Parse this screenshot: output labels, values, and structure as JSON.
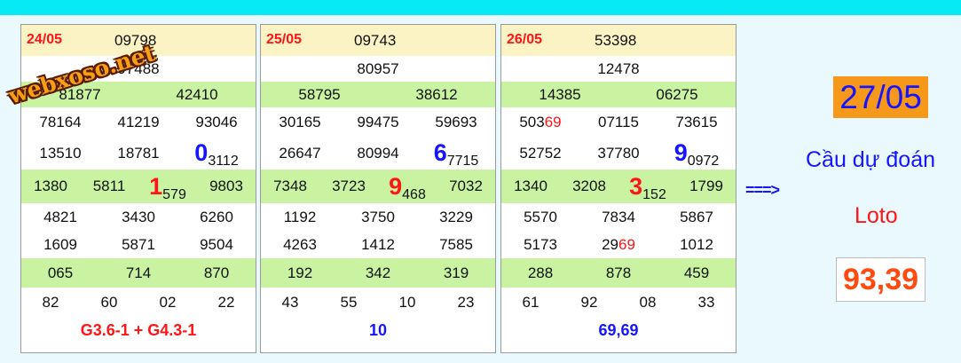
{
  "panels": [
    {
      "date": "24/05",
      "special": "09798",
      "r1": [
        "97488"
      ],
      "r2": [
        "81877",
        "42410"
      ],
      "r3": [
        "78164",
        "41219",
        "93046"
      ],
      "r4": [
        "13510",
        "18781"
      ],
      "r4_big_digit": "0",
      "r4_big_rest": "3112",
      "r5a": [
        "1380",
        "5811"
      ],
      "r5_big_digit": "1",
      "r5_big_rest": "579",
      "r5b": [
        "9803"
      ],
      "r6": [
        "4821",
        "3430",
        "6260"
      ],
      "r7": [
        "1609",
        "5871",
        "9504"
      ],
      "r8": [
        "065",
        "714",
        "870"
      ],
      "r9": [
        "82",
        "60",
        "02",
        "22"
      ],
      "footer": "G3.6-1 + G4.3-1"
    },
    {
      "date": "25/05",
      "special": "09743",
      "r1": [
        "80957"
      ],
      "r2": [
        "58795",
        "38612"
      ],
      "r3": [
        "30165",
        "99475",
        "59693"
      ],
      "r4": [
        "26647",
        "80994"
      ],
      "r4_big_digit": "6",
      "r4_big_rest": "7715",
      "r5a": [
        "7348",
        "3723"
      ],
      "r5_big_digit": "9",
      "r5_big_rest": "468",
      "r5b": [
        "7032"
      ],
      "r6": [
        "1192",
        "3750",
        "3229"
      ],
      "r7": [
        "4263",
        "1412",
        "7585"
      ],
      "r8": [
        "192",
        "342",
        "319"
      ],
      "r9": [
        "43",
        "55",
        "10",
        "23"
      ],
      "footer": "10"
    },
    {
      "date": "26/05",
      "special": "53398",
      "r1": [
        "12478"
      ],
      "r2": [
        "14385",
        "06275"
      ],
      "r3_first_a": "503",
      "r3_first_b": "69",
      "r3": [
        "07115",
        "73615"
      ],
      "r4": [
        "52752",
        "37780"
      ],
      "r4_big_digit": "9",
      "r4_big_rest": "0972",
      "r5a": [
        "1340",
        "3208"
      ],
      "r5_big_digit": "3",
      "r5_big_rest": "152",
      "r5b": [
        "1799"
      ],
      "r6": [
        "5570",
        "7834",
        "5867"
      ],
      "r7_mid_a": "29",
      "r7_mid_b": "69",
      "r7": [
        "5173",
        "1012"
      ],
      "r8": [
        "288",
        "878",
        "459"
      ],
      "r9": [
        "61",
        "92",
        "08",
        "33"
      ],
      "footer": "69,69"
    }
  ],
  "watermark": "webxoso.net",
  "arrow": "===>",
  "target_date": "27/05",
  "label_cau": "Cầu dự đoán",
  "label_loto": "Loto",
  "result": "93,39",
  "colors": {
    "top_bar": "#06eaf5",
    "header": "#fcf3c4",
    "green_row": "#c9f3a1",
    "red": "#ff1515",
    "blue": "#1515ff",
    "orange": "#f6991b"
  }
}
